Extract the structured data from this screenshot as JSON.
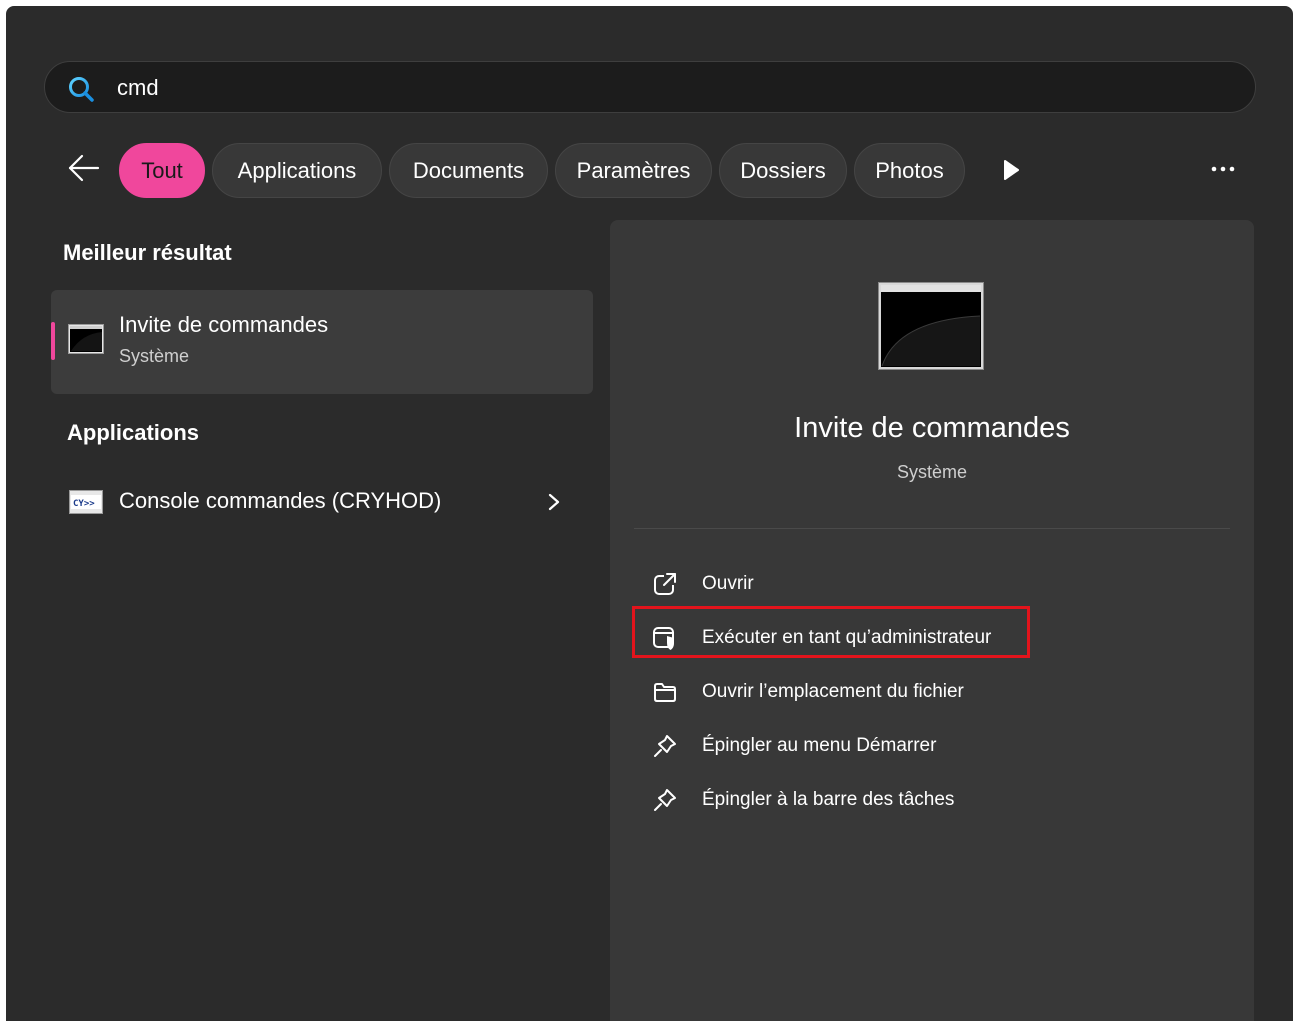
{
  "search": {
    "value": "cmd"
  },
  "filters": {
    "items": [
      "Tout",
      "Applications",
      "Documents",
      "Paramètres",
      "Dossiers",
      "Photos"
    ],
    "active": "Tout",
    "accent_color": "#f0479c"
  },
  "left": {
    "best_header": "Meilleur résultat",
    "best": {
      "title": "Invite de commandes",
      "subtitle": "Système"
    },
    "apps_header": "Applications",
    "apps": [
      {
        "label": "Console commandes (CRYHOD)"
      }
    ]
  },
  "panel": {
    "title": "Invite de commandes",
    "subtitle": "Système",
    "actions": [
      {
        "label": "Ouvrir",
        "icon": "open-external-icon"
      },
      {
        "label": "Exécuter en tant qu’administrateur",
        "icon": "shield-window-icon",
        "highlighted": true
      },
      {
        "label": "Ouvrir l’emplacement du fichier",
        "icon": "folder-icon"
      },
      {
        "label": "Épingler au menu Démarrer",
        "icon": "pin-icon"
      },
      {
        "label": "Épingler à la barre des tâches",
        "icon": "pin-icon"
      }
    ],
    "highlight_color": "#e3141c"
  }
}
